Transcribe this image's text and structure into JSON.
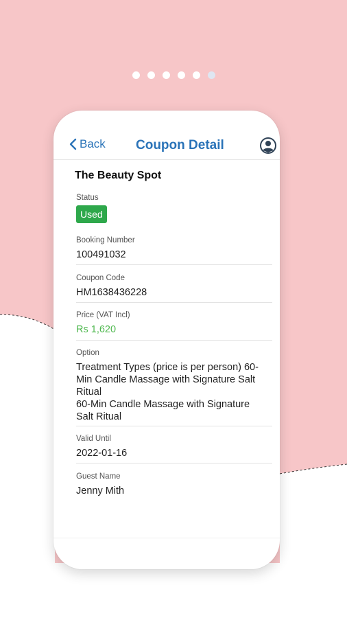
{
  "colors": {
    "background_pink": "#f7c6c8",
    "accent_blue": "#2a73b8",
    "status_green": "#2ea84b",
    "price_green": "#4fb84f"
  },
  "pager": {
    "count": 6,
    "active_index": 5
  },
  "header": {
    "back_label": "Back",
    "title": "Coupon Detail",
    "back_icon": "chevron-left-icon",
    "profile_icon": "user-avatar-icon"
  },
  "coupon": {
    "business_name": "The Beauty Spot",
    "status_label": "Status",
    "status_value": "Used",
    "booking_label": "Booking Number",
    "booking_value": "100491032",
    "code_label": "Coupon Code",
    "code_value": "HM1638436228",
    "price_label": "Price (VAT Incl)",
    "price_value": "Rs 1,620",
    "option_label": "Option",
    "option_value": "Treatment Types (price is per person) 60-\nMin Candle Massage with Signature Salt\nRitual\n60-Min Candle Massage with Signature\nSalt Ritual",
    "valid_label": "Valid Until",
    "valid_value": "2022-01-16",
    "guest_label": "Guest Name",
    "guest_value": "Jenny Mith"
  }
}
